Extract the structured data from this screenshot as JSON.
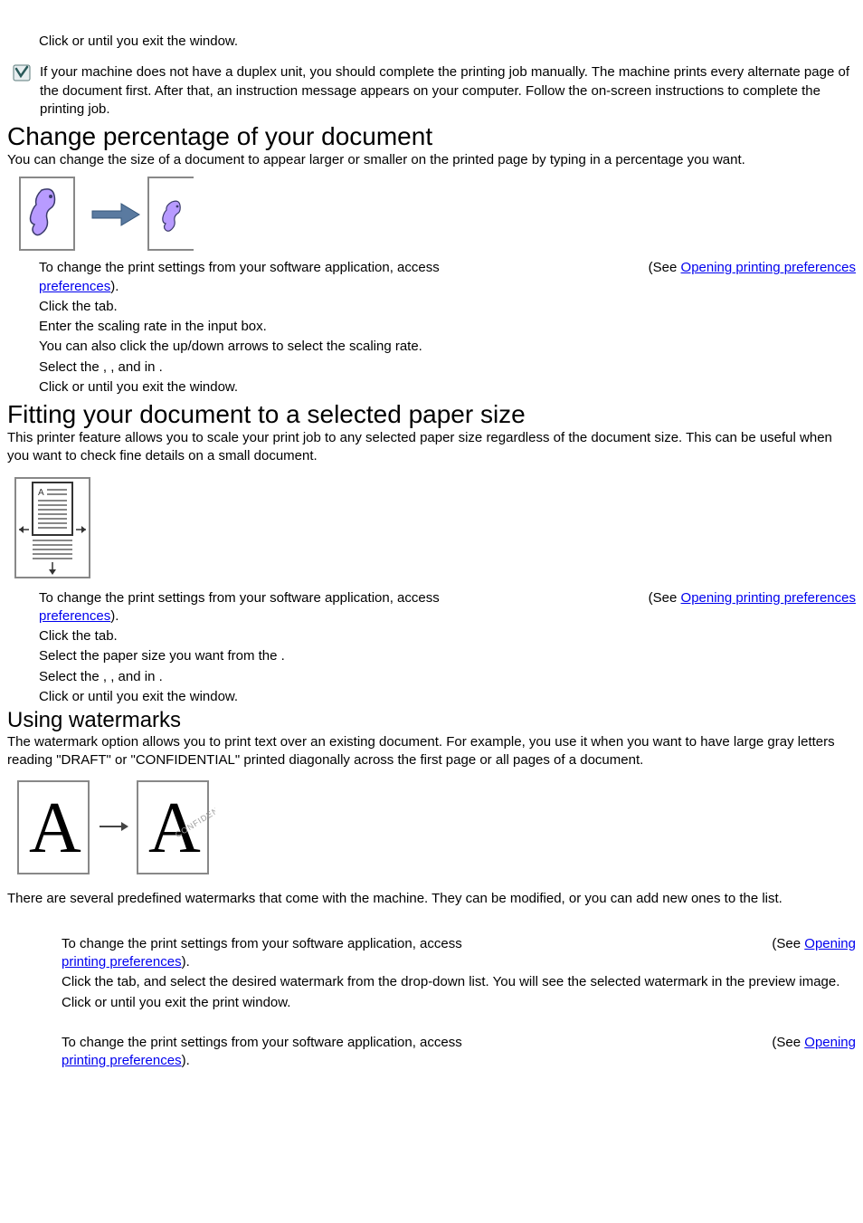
{
  "top_step": "Click       or        until you exit the         window.",
  "duplex_note": "If your machine does not have a duplex unit, you should complete the printing job manually. The machine prints every alternate page of the document first. After that, an instruction message appears on your computer. Follow the on-screen instructions to complete the printing job.",
  "sec_change": {
    "heading": "Change percentage of your document",
    "intro": "You can change the size of a document to appear larger or smaller on the printed page by typing in a percentage you want.",
    "step1_pre": "To change the print settings from your software application, access ",
    "step1_see": "(See ",
    "step1_link": "Opening printing preferences",
    "step1_close": ").",
    "step2": "Click the         tab.",
    "step3": "Enter the scaling rate in the                  input box.",
    "step3b": "You can also click the up/down arrows to select the scaling rate.",
    "step4": "Select the        ,            , and         in                     .",
    "step5": "Click       or        until you exit the         window."
  },
  "sec_fit": {
    "heading": "Fitting your document to a selected paper size",
    "intro": "This printer feature allows you to scale your print job to any selected paper size regardless of the document size. This can be useful when you want to check fine details on a small document.",
    "step1_pre": "To change the print settings from your software application, access ",
    "step1_see": "(See ",
    "step1_link": "Opening printing preferences",
    "step1_close": ").",
    "step2": "Click the         tab.",
    "step3": "Select the paper size you want from the                  .",
    "step4": "Select the        ,            , and         in                        .",
    "step5": "Click       or        until you exit the         window."
  },
  "sec_wm": {
    "heading": "Using watermarks",
    "intro": "The watermark option allows you to print text over an existing document. For example, you use it when you want to have large gray letters reading \"DRAFT\" or \"CONFIDENTIAL\" printed diagonally across the first page or all pages of a document.",
    "para2": "There are several predefined watermarks that come with the machine. They can be modified, or you can add new ones to the list.",
    "sub1": {
      "step1_pre": "To change the print settings from your software application, access ",
      "step1_see": "(See ",
      "step1_link": "Opening printing preferences",
      "step1_close": ").",
      "step2": "Click the               tab, and select the desired watermark from the                  drop-down list. You will see the selected watermark in the preview image.",
      "step3": "Click      or        until you exit the print window."
    },
    "sub2": {
      "step1_pre": "To change the print settings from your software application, access ",
      "step1_see": "(See ",
      "step1_link": "Opening printing preferences",
      "step1_close": ")."
    }
  }
}
